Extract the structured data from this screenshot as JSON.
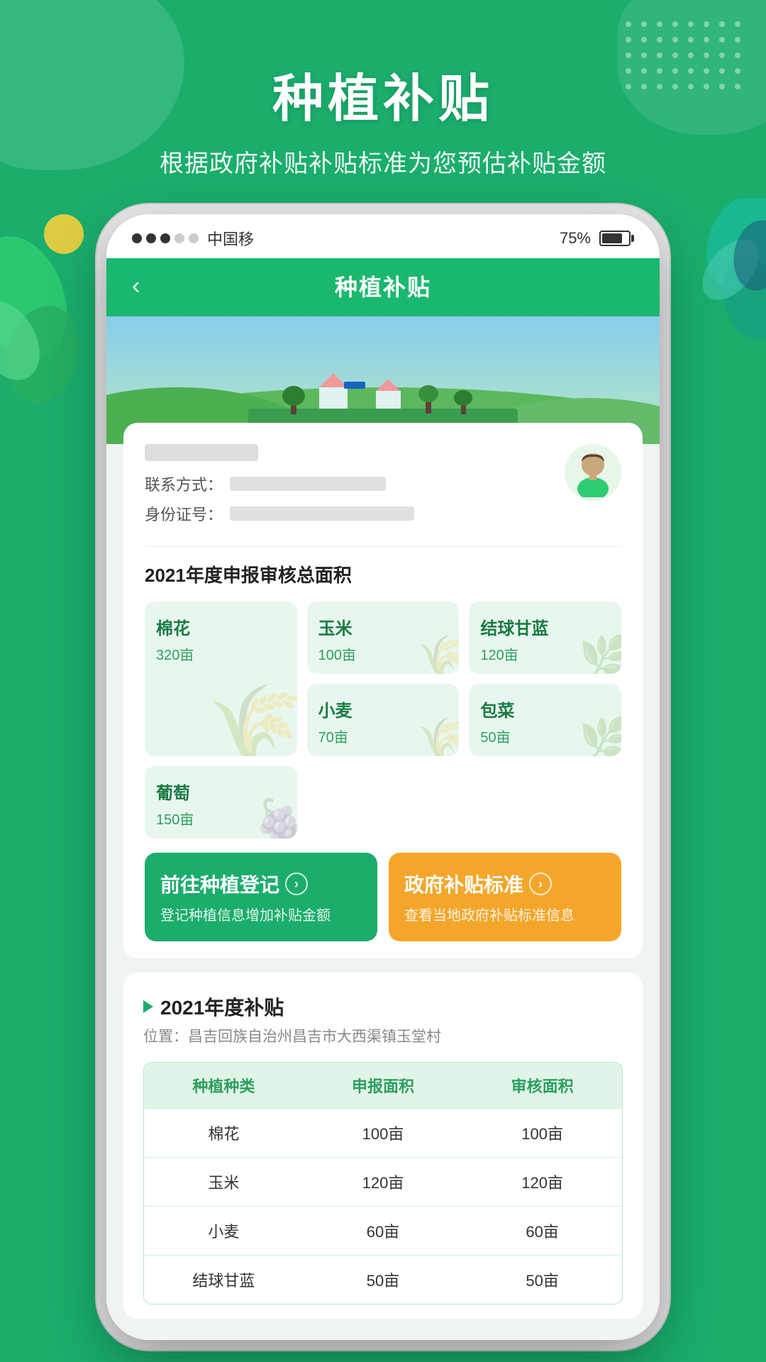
{
  "page": {
    "title": "种植补贴",
    "subtitle": "根据政府补贴补贴标准为您预估补贴金额"
  },
  "status_bar": {
    "carrier": "中国移",
    "battery_pct": "75%"
  },
  "nav": {
    "back_icon": "‹",
    "title": "种植补贴"
  },
  "user_info": {
    "contact_label": "联系方式：",
    "id_label": "身份证号："
  },
  "crops_section": {
    "title": "2021年度申报审核总面积",
    "crops": [
      {
        "name": "棉花",
        "area": "320亩",
        "large": true
      },
      {
        "name": "玉米",
        "area": "100亩",
        "large": false
      },
      {
        "name": "结球甘蓝",
        "area": "120亩",
        "large": false
      },
      {
        "name": "小麦",
        "area": "70亩",
        "large": false
      },
      {
        "name": "包菜",
        "area": "50亩",
        "large": false
      },
      {
        "name": "葡萄",
        "area": "150亩",
        "large": false
      }
    ]
  },
  "action_buttons": {
    "register": {
      "title": "前往种植登记",
      "subtitle": "登记种植信息增加补贴金额",
      "arrow": "›"
    },
    "standard": {
      "title": "政府补贴标准",
      "subtitle": "查看当地政府补贴标准信息",
      "arrow": "›"
    }
  },
  "subsidy_section": {
    "title": "2021年度补贴",
    "location_prefix": "位置：",
    "location": "昌吉回族自治州昌吉市大西渠镇玉堂村",
    "table": {
      "headers": [
        "种植种类",
        "申报面积",
        "审核面积"
      ],
      "rows": [
        [
          "棉花",
          "100亩",
          "100亩"
        ],
        [
          "玉米",
          "120亩",
          "120亩"
        ],
        [
          "小麦",
          "60亩",
          "60亩"
        ],
        [
          "结球甘蓝",
          "50亩",
          "50亩"
        ]
      ]
    }
  },
  "icons": {
    "wheat_unicode": "🌾",
    "leaf_unicode": "🍃",
    "grape_unicode": "🍇"
  }
}
